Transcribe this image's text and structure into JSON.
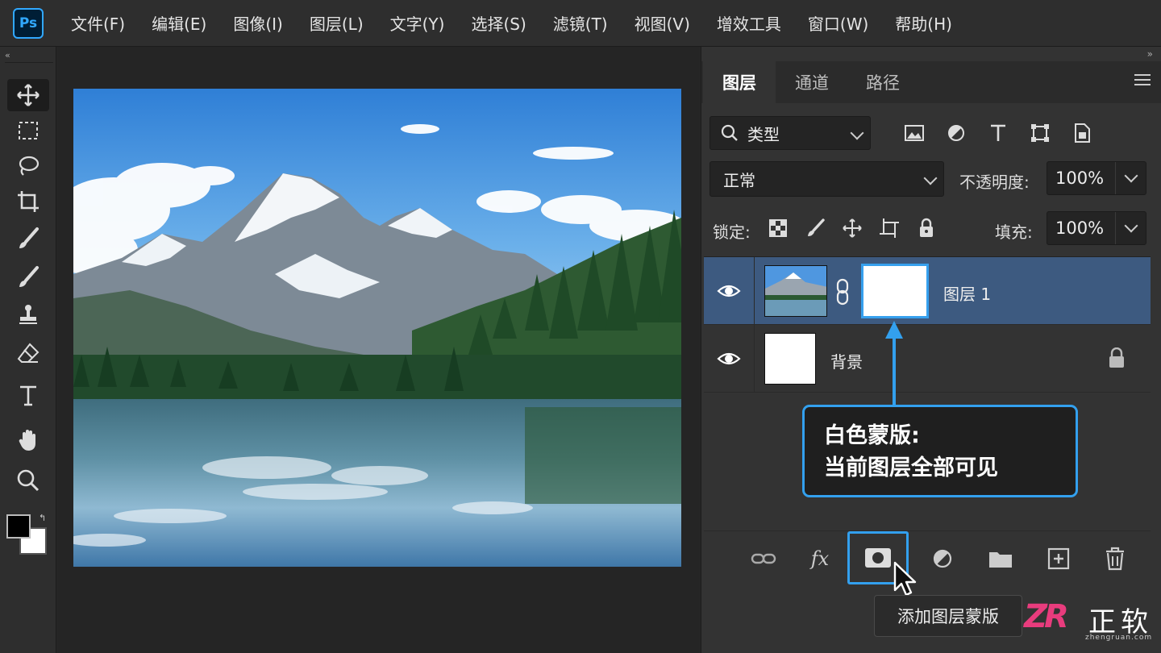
{
  "app": {
    "logo": "Ps"
  },
  "menu": [
    "文件(F)",
    "编辑(E)",
    "图像(I)",
    "图层(L)",
    "文字(Y)",
    "选择(S)",
    "滤镜(T)",
    "视图(V)",
    "增效工具",
    "窗口(W)",
    "帮助(H)"
  ],
  "toolbar": {
    "collapse": "«"
  },
  "panel": {
    "collapse": "»",
    "tabs": [
      "图层",
      "通道",
      "路径"
    ],
    "filter": {
      "label": "类型"
    },
    "blend_mode": "正常",
    "opacity_label": "不透明度:",
    "opacity_value": "100%",
    "lock_label": "锁定:",
    "fill_label": "填充:",
    "fill_value": "100%",
    "layers": [
      {
        "name": "图层 1",
        "selected": true,
        "has_mask": true
      },
      {
        "name": "背景",
        "selected": false,
        "locked": true
      }
    ]
  },
  "callout": {
    "line1": "白色蒙版:",
    "line2": "当前图层全部可见"
  },
  "tooltip": "添加图层蒙版",
  "watermark": {
    "logo": "ZR",
    "text": "正软",
    "url": "zhengruan.com"
  },
  "colors": {
    "accent": "#33a0ee",
    "selected_layer": "#3d5a80",
    "ps_blue": "#31a8ff"
  }
}
